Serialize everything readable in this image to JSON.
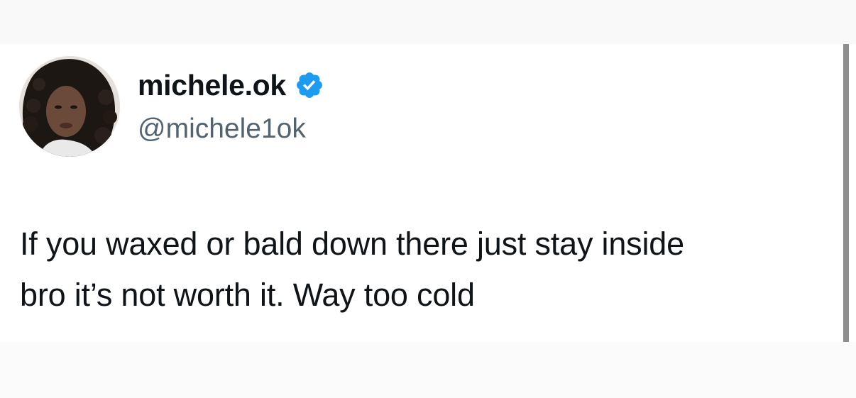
{
  "tweet": {
    "author": {
      "display_name": "michele.ok",
      "handle": "@michele1ok",
      "verified": true,
      "verified_icon": "verified-badge-icon",
      "avatar": "profile-photo"
    },
    "text_lines": [
      "If you waxed or bald down there just stay inside",
      "bro it’s not worth it. Way too cold"
    ]
  },
  "colors": {
    "text_primary": "#0f1419",
    "text_secondary": "#536471",
    "verified_blue": "#1d9bf0",
    "background": "#ffffff",
    "scrollbar": "#8e8e8e"
  }
}
